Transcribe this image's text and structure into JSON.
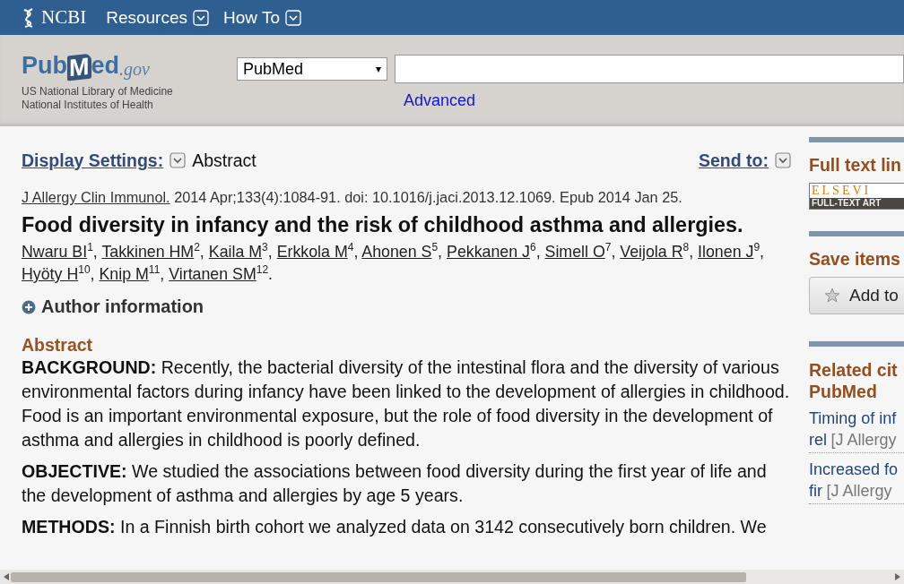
{
  "topbar": {
    "brand": "NCBI",
    "menus": [
      {
        "label": "Resources"
      },
      {
        "label": "How To"
      }
    ]
  },
  "header": {
    "logo": {
      "pub": "Pub",
      "m": "M",
      "ed": "ed",
      "gov": ".gov"
    },
    "org_lines": [
      "US National Library of Medicine",
      "National Institutes of Health"
    ],
    "database": "PubMed",
    "database_arrow": "▾",
    "advanced": "Advanced"
  },
  "display": {
    "label": "Display Settings:",
    "value": "Abstract",
    "send_to": "Send to:"
  },
  "citation": {
    "journal": "J Allergy Clin Immunol.",
    "details": "2014 Apr;133(4):1084-91. doi: 10.1016/j.jaci.2013.12.1069. Epub 2014 Jan 25."
  },
  "title": "Food diversity in infancy and the risk of childhood asthma and allergies.",
  "authors": [
    {
      "name": "Nwaru BI",
      "sup": "1",
      "sep": ","
    },
    {
      "name": "Takkinen HM",
      "sup": "2",
      "sep": ","
    },
    {
      "name": "Kaila M",
      "sup": "3",
      "sep": ","
    },
    {
      "name": "Erkkola M",
      "sup": "4",
      "sep": ","
    },
    {
      "name": "Ahonen S",
      "sup": "5",
      "sep": ","
    },
    {
      "name": "Pekkanen J",
      "sup": "6",
      "sep": ","
    },
    {
      "name": "Simell O",
      "sup": "7",
      "sep": ","
    },
    {
      "name": "Veijola R",
      "sup": "8",
      "sep": ","
    },
    {
      "name": "Ilonen J",
      "sup": "9",
      "sep": ","
    },
    {
      "name": "Hyöty H",
      "sup": "10",
      "sep": ","
    },
    {
      "name": "Knip M",
      "sup": "11",
      "sep": ","
    },
    {
      "name": "Virtanen SM",
      "sup": "12",
      "sep": "."
    }
  ],
  "author_info": {
    "label": "Author information",
    "expanded": false
  },
  "abstract": {
    "heading": "Abstract",
    "sections": [
      {
        "text": "**BACKGROUND:** Recently, the bacterial diversity of the intestinal flora and the diversity of various environmental factors during infancy have been linked to the development of allergies in childhood. Food is an important environmental exposure, but the role of food diversity in the development of asthma and allergies in childhood is poorly defined."
      },
      {
        "text": "**OBJECTIVE:** We studied the associations between food diversity during the first year of life and the development of asthma and allergies by age 5 years."
      },
      {
        "text": "**METHODS:** In a Finnish birth cohort we analyzed data on 3142 consecutively born children. We"
      }
    ]
  },
  "sidebar": {
    "full_text": {
      "heading": "Full text lin",
      "badge_top": "ELSEVI",
      "badge_bottom": "FULL-TEXT ART"
    },
    "save": {
      "heading": "Save items",
      "button": "Add to"
    },
    "related": {
      "heading_lines": [
        "Related cit",
        "PubMed"
      ],
      "items": [
        {
          "title": "Timing of inf",
          "rest": "rel",
          "source": "[J Allergy"
        },
        {
          "title": "Increased fo",
          "rest": "fir",
          "source": "[J Allergy"
        }
      ]
    }
  }
}
